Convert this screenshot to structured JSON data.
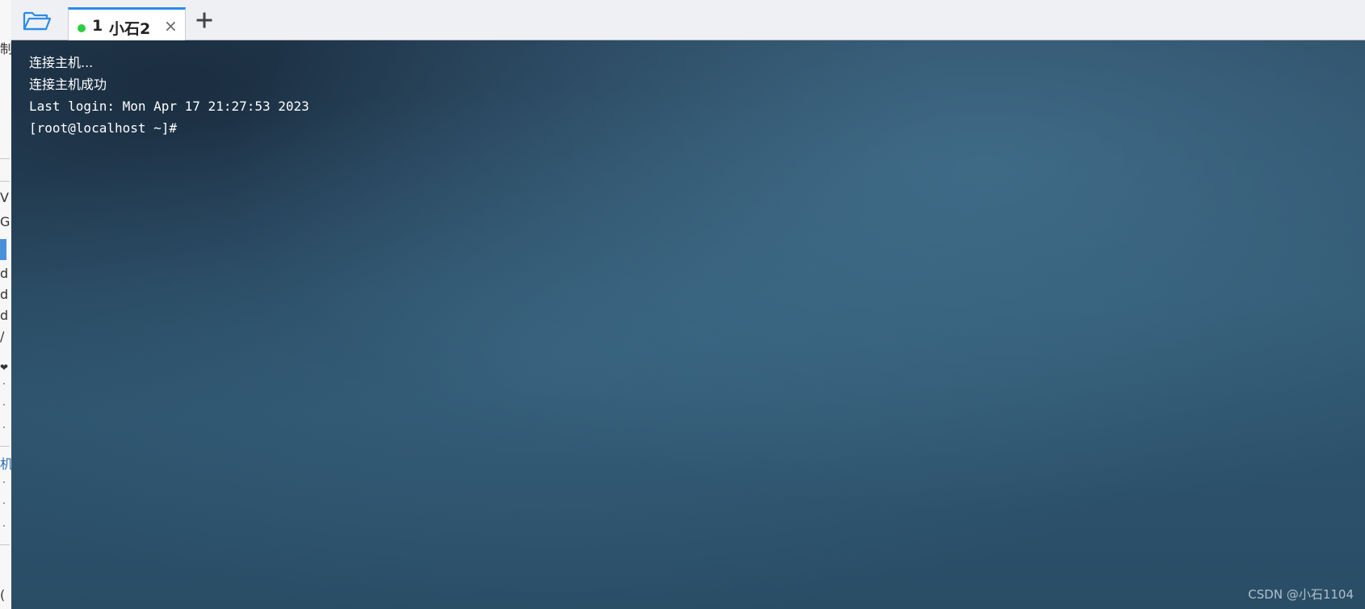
{
  "left_panel": {
    "glyphs": [
      "制",
      "V",
      "G",
      "d",
      "d",
      "d",
      "/",
      "❤",
      "机",
      "("
    ]
  },
  "tab_bar": {
    "folder_icon": "folder-open-icon",
    "tabs": [
      {
        "number": "1",
        "name": "小石2",
        "status_color": "#2ecc40",
        "active": true,
        "close_label": "×"
      }
    ],
    "add_tab_icon": "plus-icon"
  },
  "terminal": {
    "lines": [
      "连接主机...",
      "连接主机成功",
      "Last login: Mon Apr 17 21:27:53 2023",
      "[root@localhost ~]#"
    ],
    "colors": {
      "text": "#ffffff",
      "background": "#2f5670",
      "accent": "#2b8ce8"
    }
  },
  "watermark": "CSDN @小石1104"
}
